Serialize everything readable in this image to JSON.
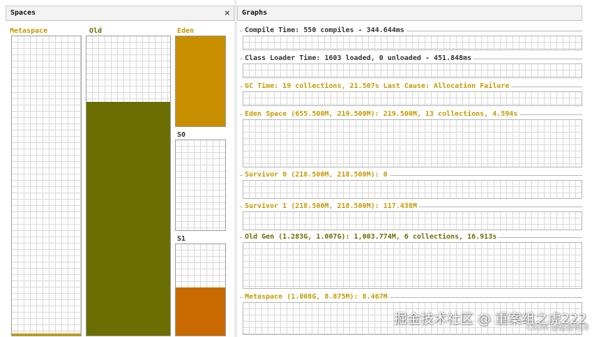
{
  "spaces_panel": {
    "title": "Spaces",
    "close_glyph": "×",
    "spaces": {
      "metaspace": {
        "label": "Metaspace",
        "fill_fraction": 0.01,
        "fill_color": "#c49a00"
      },
      "old": {
        "label": "Old",
        "fill_fraction": 0.78,
        "fill_color": "#6b6e00"
      },
      "eden": {
        "label": "Eden",
        "fill_fraction": 1.0,
        "fill_color": "#c78e00"
      },
      "s0": {
        "label": "S0",
        "fill_fraction": 0.0,
        "fill_color": "#c86a00"
      },
      "s1": {
        "label": "S1",
        "fill_fraction": 0.53,
        "fill_color": "#c86a00"
      }
    }
  },
  "graphs_panel": {
    "title": "Graphs",
    "graphs": {
      "compile": {
        "label": "Compile Time: 550 compiles - 344.644ms",
        "color": "#333333"
      },
      "class_loader": {
        "label": "Class Loader Time: 1603 loaded, 0 unloaded - 451.848ms",
        "color": "#333333"
      },
      "gc": {
        "label": "GC Time: 19 collections, 21.507s  Last Cause: Allocation Failure",
        "color": "#c49a00"
      },
      "eden": {
        "label": "Eden Space (655.500M, 219.500M): 219.500M, 13 collections, 4.594s",
        "color": "#c49a00"
      },
      "survivor0": {
        "label": "Survivor 0 (218.500M, 218.500M): 0",
        "color": "#c49a00"
      },
      "survivor1": {
        "label": "Survivor 1 (218.500M, 218.500M): 117.438M",
        "color": "#c49a00"
      },
      "old_gen": {
        "label": "Old Gen (1.283G, 1.007G): 1,003.774M, 6 collections, 16.913s",
        "color": "#6b6b00"
      },
      "metaspace": {
        "label": "Metaspace (1.008G, 8.875M): 8.467M",
        "color": "#c49a00"
      }
    }
  },
  "watermark": {
    "text": "掘金技术社区 @ 重案组之虎222",
    "sub": "CSDN @甜技啊洋"
  }
}
